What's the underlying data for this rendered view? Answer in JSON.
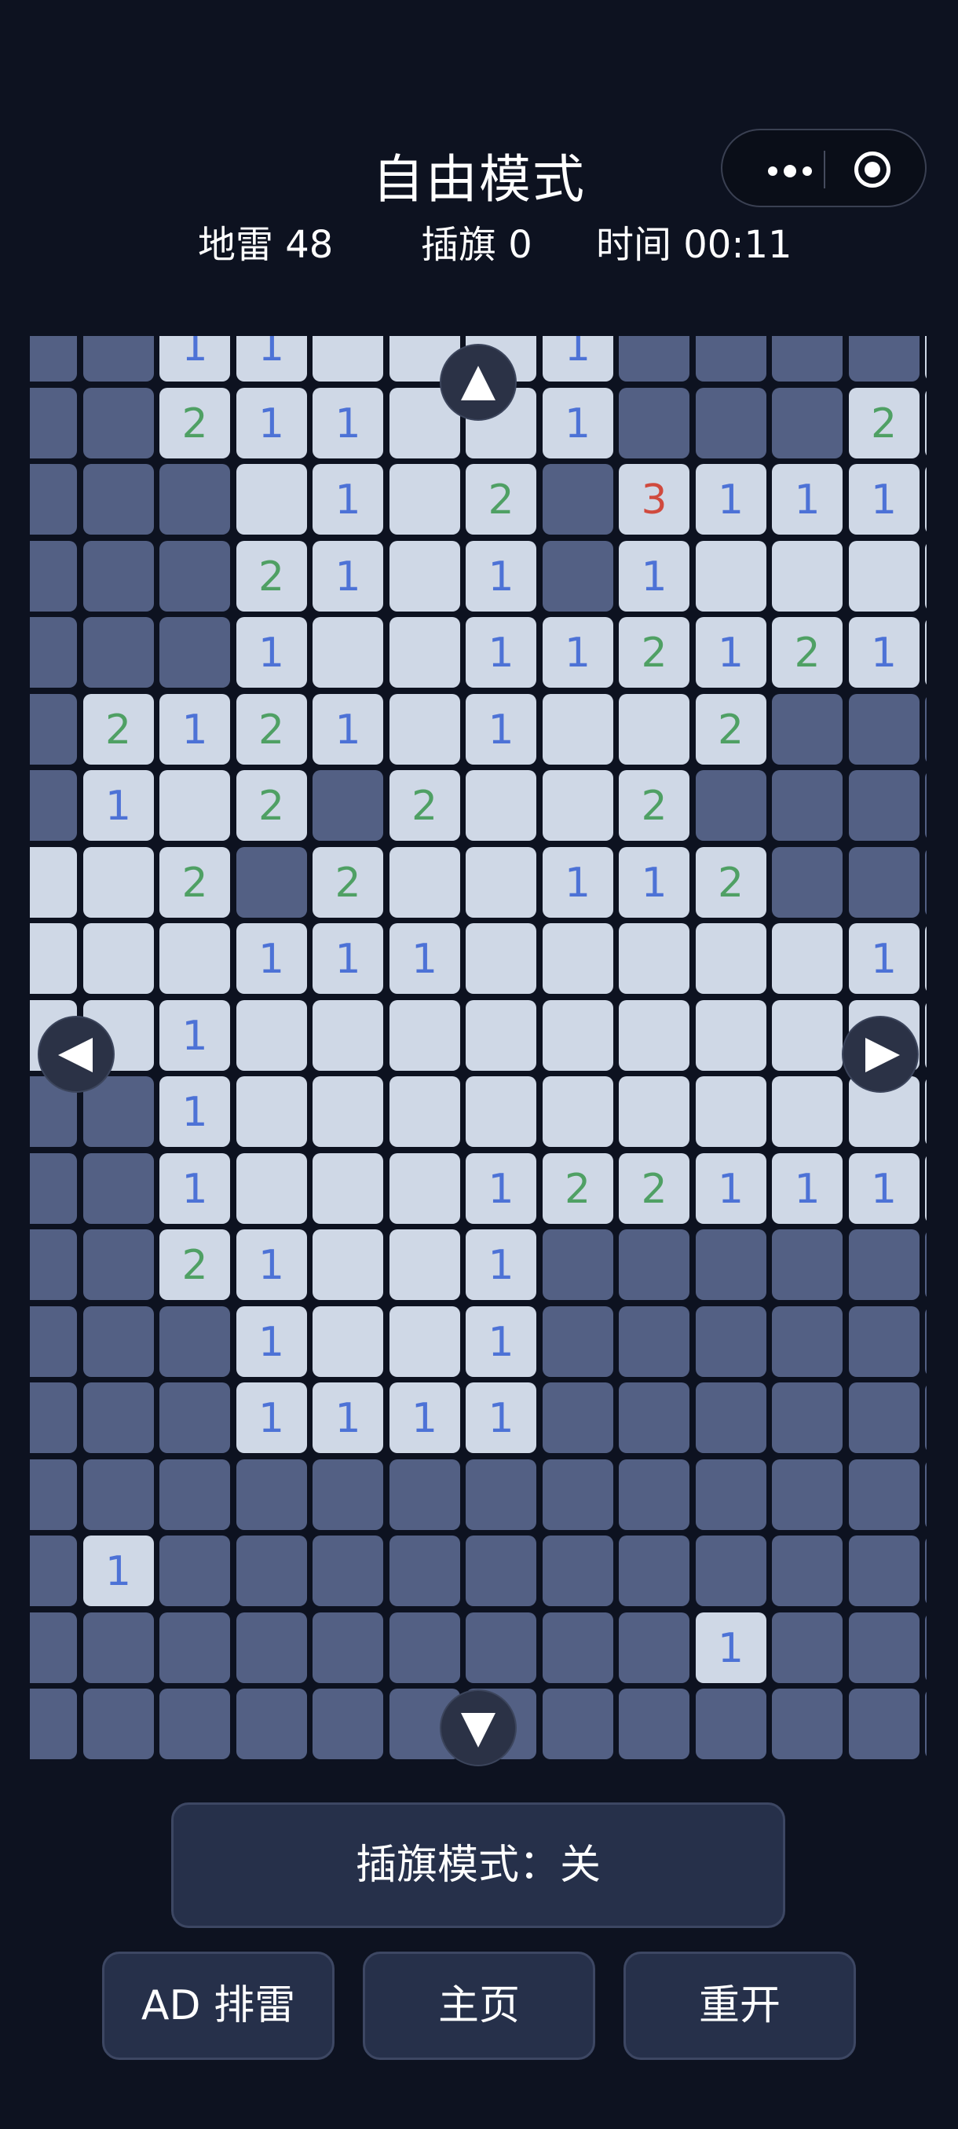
{
  "header": {
    "title": "自由模式",
    "mines": "地雷 48",
    "flags": "插旗 0",
    "time": "时间 00:11"
  },
  "capsule": {
    "more_icon": "more-dots-icon",
    "close_icon": "target-circle-icon"
  },
  "board": {
    "columns": 13,
    "rows": 19,
    "legend": "# = hidden cell, . = opened empty cell, digit = adjacent mine count",
    "cells": [
      "##11...1####1.",
      "##211..1###21.",
      "###.1.2#3111..",
      "###21.1#1.....",
      "###1..1121211.",
      "#2121.1..2###.",
      "#1.2#2..2####",
      "..2#2..112###",
      "...111.....11.",
      "..1...........",
      "##1...........",
      "##1...1221111",
      "##21..1#######",
      "###1..1#######",
      "###1111#######",
      "##############",
      "#1############",
      "#########1####",
      "##############"
    ]
  },
  "controls": {
    "flag_mode": "插旗模式：关",
    "ad_sweep": "AD 排雷",
    "home": "主页",
    "restart": "重开"
  },
  "colors": {
    "background": "#0d1220",
    "hidden_cell": "#536084",
    "open_cell": "#cfd8e6",
    "num_1": "#4d72d6",
    "num_2": "#4fa064",
    "num_3": "#d04a3e",
    "button": "#26304a"
  }
}
